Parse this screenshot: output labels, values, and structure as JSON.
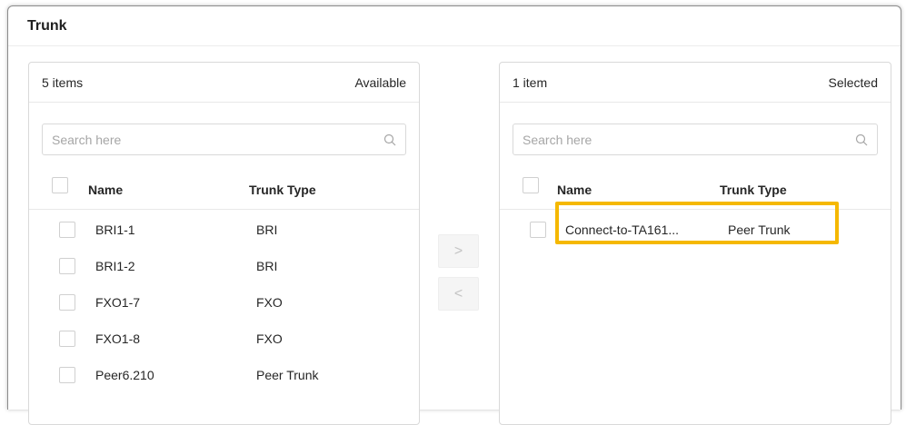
{
  "card": {
    "title": "Trunk"
  },
  "available": {
    "count_label": "5 items",
    "caption": "Available",
    "search_placeholder": "Search here",
    "columns": {
      "name": "Name",
      "type": "Trunk Type"
    },
    "rows": [
      {
        "name": "BRI1-1",
        "type": "BRI"
      },
      {
        "name": "BRI1-2",
        "type": "BRI"
      },
      {
        "name": "FXO1-7",
        "type": "FXO"
      },
      {
        "name": "FXO1-8",
        "type": "FXO"
      },
      {
        "name": "Peer6.210",
        "type": "Peer Trunk"
      }
    ]
  },
  "selected": {
    "count_label": "1 item",
    "caption": "Selected",
    "search_placeholder": "Search here",
    "columns": {
      "name": "Name",
      "type": "Trunk Type"
    },
    "rows": [
      {
        "name": "Connect-to-TA161...",
        "type": "Peer Trunk"
      }
    ]
  },
  "transfer": {
    "move_right": ">",
    "move_left": "<"
  },
  "colors": {
    "highlight": "#f5b800",
    "border": "#d9d9d9"
  }
}
